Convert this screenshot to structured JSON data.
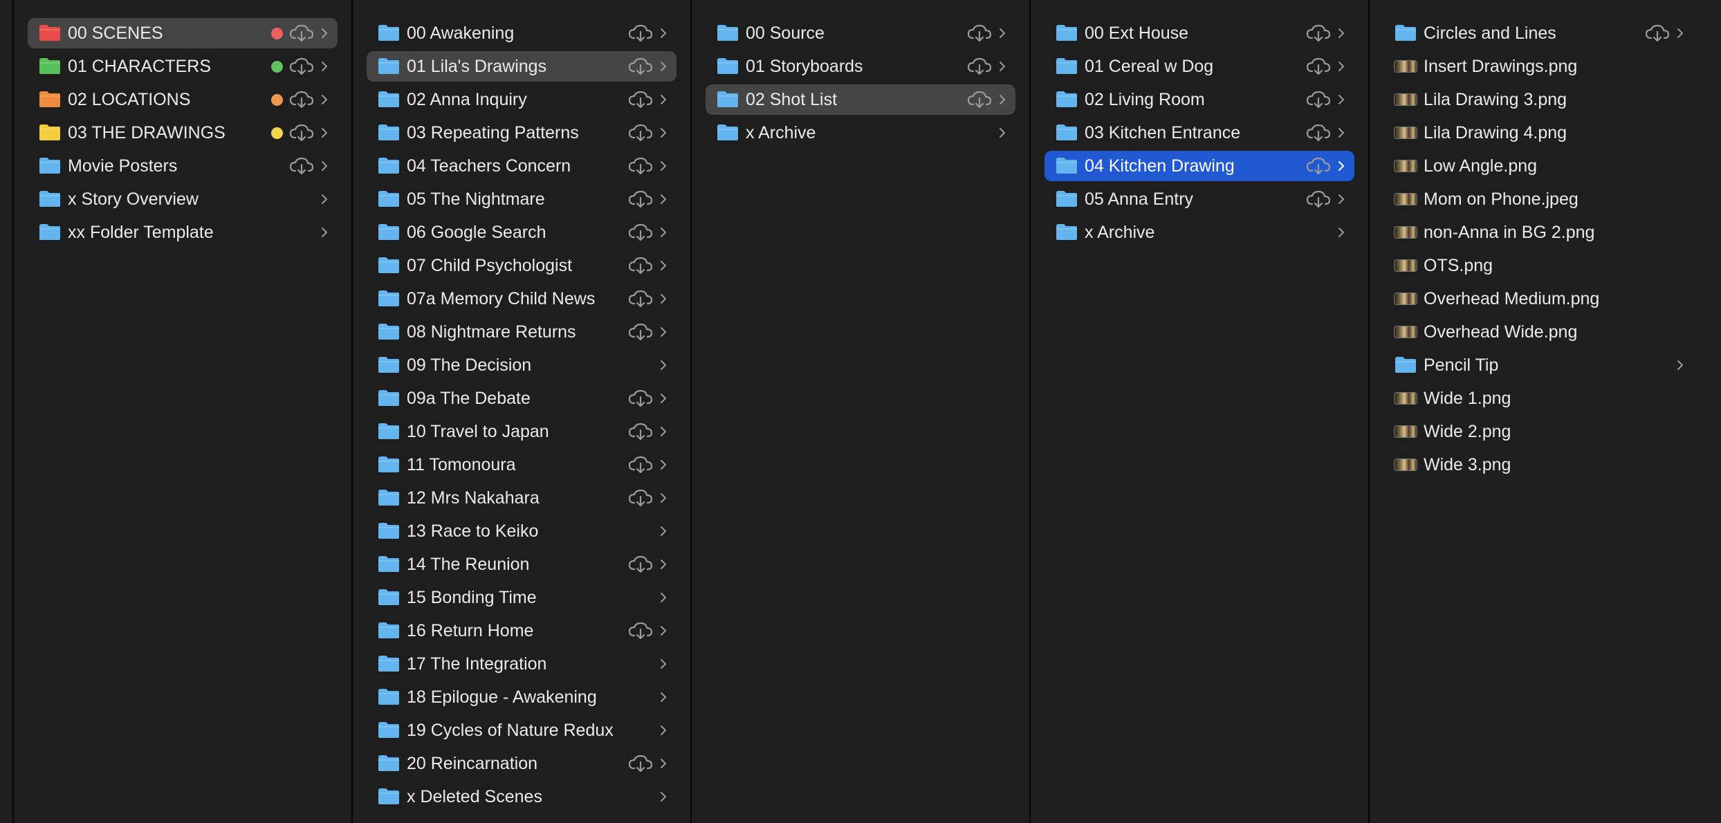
{
  "colors": {
    "window_bg": "#1f1e1f",
    "active_row": "#454546",
    "selected_row": "#2159d2",
    "folder_blue": "#62b5ee",
    "tag_red": "#ec5f5f",
    "tag_green": "#5fc35f",
    "tag_orange": "#f0994c",
    "tag_yellow": "#f5d54b"
  },
  "columns": [
    {
      "items": [
        {
          "label": "00 SCENES",
          "icon": "folder-red-icon",
          "folder_color": "#ea4a4a",
          "tag": "red",
          "cloud": true,
          "chevron": true,
          "state": "active"
        },
        {
          "label": "01 CHARACTERS",
          "icon": "folder-green-icon",
          "folder_color": "#56c05a",
          "tag": "green",
          "cloud": true,
          "chevron": true
        },
        {
          "label": "02 LOCATIONS",
          "icon": "folder-orange-icon",
          "folder_color": "#f08a3c",
          "tag": "orange",
          "cloud": true,
          "chevron": true
        },
        {
          "label": "03 THE DRAWINGS",
          "icon": "folder-yellow-icon",
          "folder_color": "#f4cd3a",
          "tag": "yellow",
          "cloud": true,
          "chevron": true
        },
        {
          "label": "Movie Posters",
          "icon": "folder-icon",
          "cloud": true,
          "chevron": true
        },
        {
          "label": "x Story Overview",
          "icon": "folder-icon",
          "cloud": false,
          "chevron": true
        },
        {
          "label": "xx Folder Template",
          "icon": "folder-icon",
          "cloud": false,
          "chevron": true
        }
      ]
    },
    {
      "items": [
        {
          "label": "00 Awakening",
          "icon": "folder-icon",
          "cloud": true,
          "chevron": true
        },
        {
          "label": "01 Lila's Drawings",
          "icon": "folder-icon",
          "cloud": true,
          "chevron": true,
          "state": "active"
        },
        {
          "label": "02 Anna Inquiry",
          "icon": "folder-icon",
          "cloud": true,
          "chevron": true
        },
        {
          "label": "03 Repeating Patterns",
          "icon": "folder-icon",
          "cloud": true,
          "chevron": true
        },
        {
          "label": "04 Teachers Concern",
          "icon": "folder-icon",
          "cloud": true,
          "chevron": true
        },
        {
          "label": "05 The Nightmare",
          "icon": "folder-icon",
          "cloud": true,
          "chevron": true
        },
        {
          "label": "06 Google Search",
          "icon": "folder-icon",
          "cloud": true,
          "chevron": true
        },
        {
          "label": "07 Child Psychologist",
          "icon": "folder-icon",
          "cloud": true,
          "chevron": true
        },
        {
          "label": "07a Memory Child News",
          "icon": "folder-icon",
          "cloud": true,
          "chevron": true
        },
        {
          "label": "08 Nightmare Returns",
          "icon": "folder-icon",
          "cloud": true,
          "chevron": true
        },
        {
          "label": "09 The Decision",
          "icon": "folder-icon",
          "cloud": false,
          "chevron": true
        },
        {
          "label": "09a The Debate",
          "icon": "folder-icon",
          "cloud": true,
          "chevron": true
        },
        {
          "label": "10 Travel to Japan",
          "icon": "folder-icon",
          "cloud": true,
          "chevron": true
        },
        {
          "label": "11 Tomonoura",
          "icon": "folder-icon",
          "cloud": true,
          "chevron": true
        },
        {
          "label": "12 Mrs Nakahara",
          "icon": "folder-icon",
          "cloud": true,
          "chevron": true
        },
        {
          "label": "13 Race to Keiko",
          "icon": "folder-icon",
          "cloud": false,
          "chevron": true
        },
        {
          "label": "14 The Reunion",
          "icon": "folder-icon",
          "cloud": true,
          "chevron": true
        },
        {
          "label": "15 Bonding Time",
          "icon": "folder-icon",
          "cloud": false,
          "chevron": true
        },
        {
          "label": "16 Return Home",
          "icon": "folder-icon",
          "cloud": true,
          "chevron": true
        },
        {
          "label": "17 The Integration",
          "icon": "folder-icon",
          "cloud": false,
          "chevron": true
        },
        {
          "label": "18 Epilogue - Awakening",
          "icon": "folder-icon",
          "cloud": false,
          "chevron": true
        },
        {
          "label": "19 Cycles of Nature Redux",
          "icon": "folder-icon",
          "cloud": false,
          "chevron": true
        },
        {
          "label": "20 Reincarnation",
          "icon": "folder-icon",
          "cloud": true,
          "chevron": true
        },
        {
          "label": "x Deleted Scenes",
          "icon": "folder-icon",
          "cloud": false,
          "chevron": true
        }
      ]
    },
    {
      "items": [
        {
          "label": "00 Source",
          "icon": "folder-icon",
          "cloud": true,
          "chevron": true
        },
        {
          "label": "01 Storyboards",
          "icon": "folder-icon",
          "cloud": true,
          "chevron": true
        },
        {
          "label": "02 Shot List",
          "icon": "folder-icon",
          "cloud": true,
          "chevron": true,
          "state": "active"
        },
        {
          "label": "x Archive",
          "icon": "folder-icon",
          "cloud": false,
          "chevron": true
        }
      ]
    },
    {
      "items": [
        {
          "label": "00 Ext House",
          "icon": "folder-icon",
          "cloud": true,
          "chevron": true
        },
        {
          "label": "01 Cereal w Dog",
          "icon": "folder-icon",
          "cloud": true,
          "chevron": true
        },
        {
          "label": "02 Living Room",
          "icon": "folder-icon",
          "cloud": true,
          "chevron": true
        },
        {
          "label": "03 Kitchen Entrance",
          "icon": "folder-icon",
          "cloud": true,
          "chevron": true
        },
        {
          "label": "04 Kitchen Drawing",
          "icon": "folder-icon",
          "cloud": true,
          "chevron": true,
          "state": "selected"
        },
        {
          "label": "05 Anna Entry",
          "icon": "folder-icon",
          "cloud": true,
          "chevron": true
        },
        {
          "label": "x Archive",
          "icon": "folder-icon",
          "cloud": false,
          "chevron": true
        }
      ]
    },
    {
      "items": [
        {
          "label": "Circles and Lines",
          "icon": "folder-icon",
          "cloud": true,
          "chevron": true
        },
        {
          "label": "Insert Drawings.png",
          "icon": "image-thumbnail-icon",
          "cloud": false,
          "chevron": false
        },
        {
          "label": "Lila Drawing 3.png",
          "icon": "image-thumbnail-icon",
          "cloud": false,
          "chevron": false
        },
        {
          "label": "Lila Drawing 4.png",
          "icon": "image-thumbnail-icon",
          "cloud": false,
          "chevron": false
        },
        {
          "label": "Low Angle.png",
          "icon": "image-thumbnail-icon",
          "cloud": false,
          "chevron": false
        },
        {
          "label": "Mom on Phone.jpeg",
          "icon": "image-thumbnail-icon",
          "cloud": false,
          "chevron": false
        },
        {
          "label": "non-Anna in BG 2.png",
          "icon": "image-thumbnail-icon",
          "cloud": false,
          "chevron": false
        },
        {
          "label": "OTS.png",
          "icon": "image-thumbnail-icon",
          "cloud": false,
          "chevron": false
        },
        {
          "label": "Overhead Medium.png",
          "icon": "image-thumbnail-icon",
          "cloud": false,
          "chevron": false
        },
        {
          "label": "Overhead Wide.png",
          "icon": "image-thumbnail-icon",
          "cloud": false,
          "chevron": false
        },
        {
          "label": "Pencil Tip",
          "icon": "folder-icon",
          "cloud": false,
          "chevron": true
        },
        {
          "label": "Wide 1.png",
          "icon": "image-thumbnail-icon",
          "cloud": false,
          "chevron": false
        },
        {
          "label": "Wide 2.png",
          "icon": "image-thumbnail-icon",
          "cloud": false,
          "chevron": false
        },
        {
          "label": "Wide 3.png",
          "icon": "image-thumbnail-icon",
          "cloud": false,
          "chevron": false
        }
      ]
    }
  ]
}
